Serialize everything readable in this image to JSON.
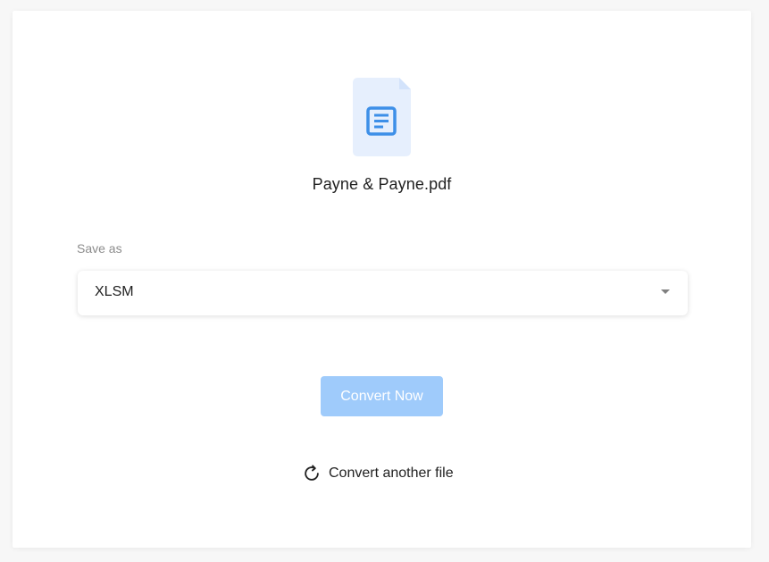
{
  "file": {
    "icon": "document-icon",
    "name": "Payne & Payne.pdf"
  },
  "save_as": {
    "label": "Save as",
    "selected": "XLSM"
  },
  "actions": {
    "convert_label": "Convert Now",
    "another_label": "Convert another file"
  },
  "colors": {
    "accent": "#3d8fe8",
    "file_bg": "#e6effd",
    "button_bg": "#9fcbfb"
  }
}
